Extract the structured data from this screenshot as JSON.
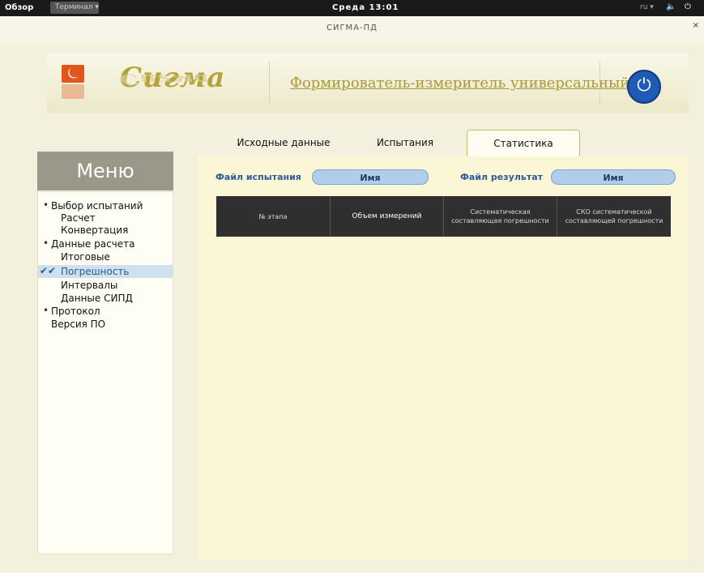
{
  "topbar": {
    "activities": "Обзор",
    "app_menu": "Терминал ▾",
    "clock": "Среда 13:01",
    "lang": "ru ▾",
    "volume_icon": "speaker-icon",
    "power_icon": "power-icon"
  },
  "window": {
    "title": "СИГМА-ПД",
    "close": "×"
  },
  "header": {
    "logo_text": "Сигма",
    "title": "Формирователь-измеритель универсальный",
    "power_button_icon": "power-icon"
  },
  "menu": {
    "title": "Меню",
    "items": [
      {
        "label": "Выбор испытаний",
        "bullet": "•"
      },
      {
        "label": "Расчет"
      },
      {
        "label": "Конвертация"
      },
      {
        "label": "Данные расчета",
        "bullet": "•"
      },
      {
        "label": "Итоговые"
      },
      {
        "label": "Погрешность",
        "checks": "✔✔",
        "selected": true
      },
      {
        "label": "Интервалы"
      },
      {
        "label": "Данные СИПД"
      },
      {
        "label": "Протокол",
        "bullet": "•"
      },
      {
        "label": "Версия ПО"
      }
    ]
  },
  "tabs": [
    {
      "label": "Исходные данные"
    },
    {
      "label": "Испытания"
    },
    {
      "label": "Статистика",
      "active": true
    }
  ],
  "files": {
    "test_label": "Файл испытания",
    "test_value": "Имя",
    "result_label": "Файл результат",
    "result_value": "Имя"
  },
  "table": {
    "columns": [
      "№ этапа",
      "Объем измерений",
      "Систематическая составляющая погрешности",
      "СКО систематической составляющей погрешности"
    ],
    "rows": []
  },
  "colors": {
    "accent": "#2f5b97",
    "header_gold": "#b4a43a",
    "menu_header": "#9a9888",
    "content_bg": "#fbf6d6"
  }
}
